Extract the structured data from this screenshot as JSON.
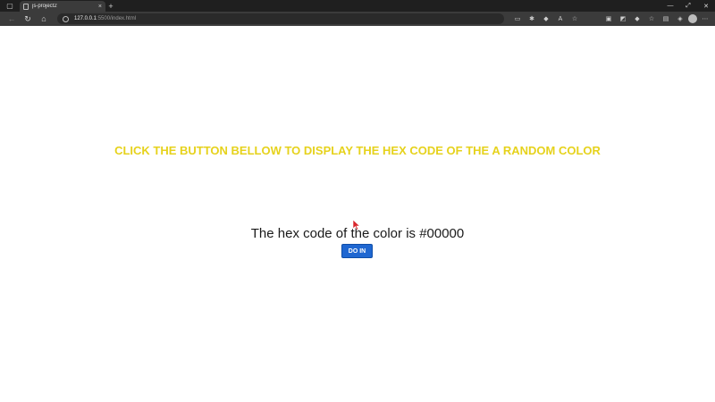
{
  "browser": {
    "tab_title": "js-project2",
    "tab_close": "×",
    "new_tab": "+",
    "url_host": "127.0.0.1",
    "url_rest": ":5500/index.html",
    "window_controls": [
      "—",
      "⤢",
      "✕"
    ]
  },
  "page": {
    "headline": "CLICK THE BUTTON BELLOW TO DISPLAY THE HEX CODE OF THE A RANDOM COLOR",
    "hex_text": "The hex code of the color is #00000",
    "button_label": "DO IN"
  },
  "colors": {
    "headline": "#e6d21c",
    "button_bg": "#1f67d1",
    "chrome_dark": "#1f1f1f",
    "toolbar": "#3b3b3b"
  }
}
